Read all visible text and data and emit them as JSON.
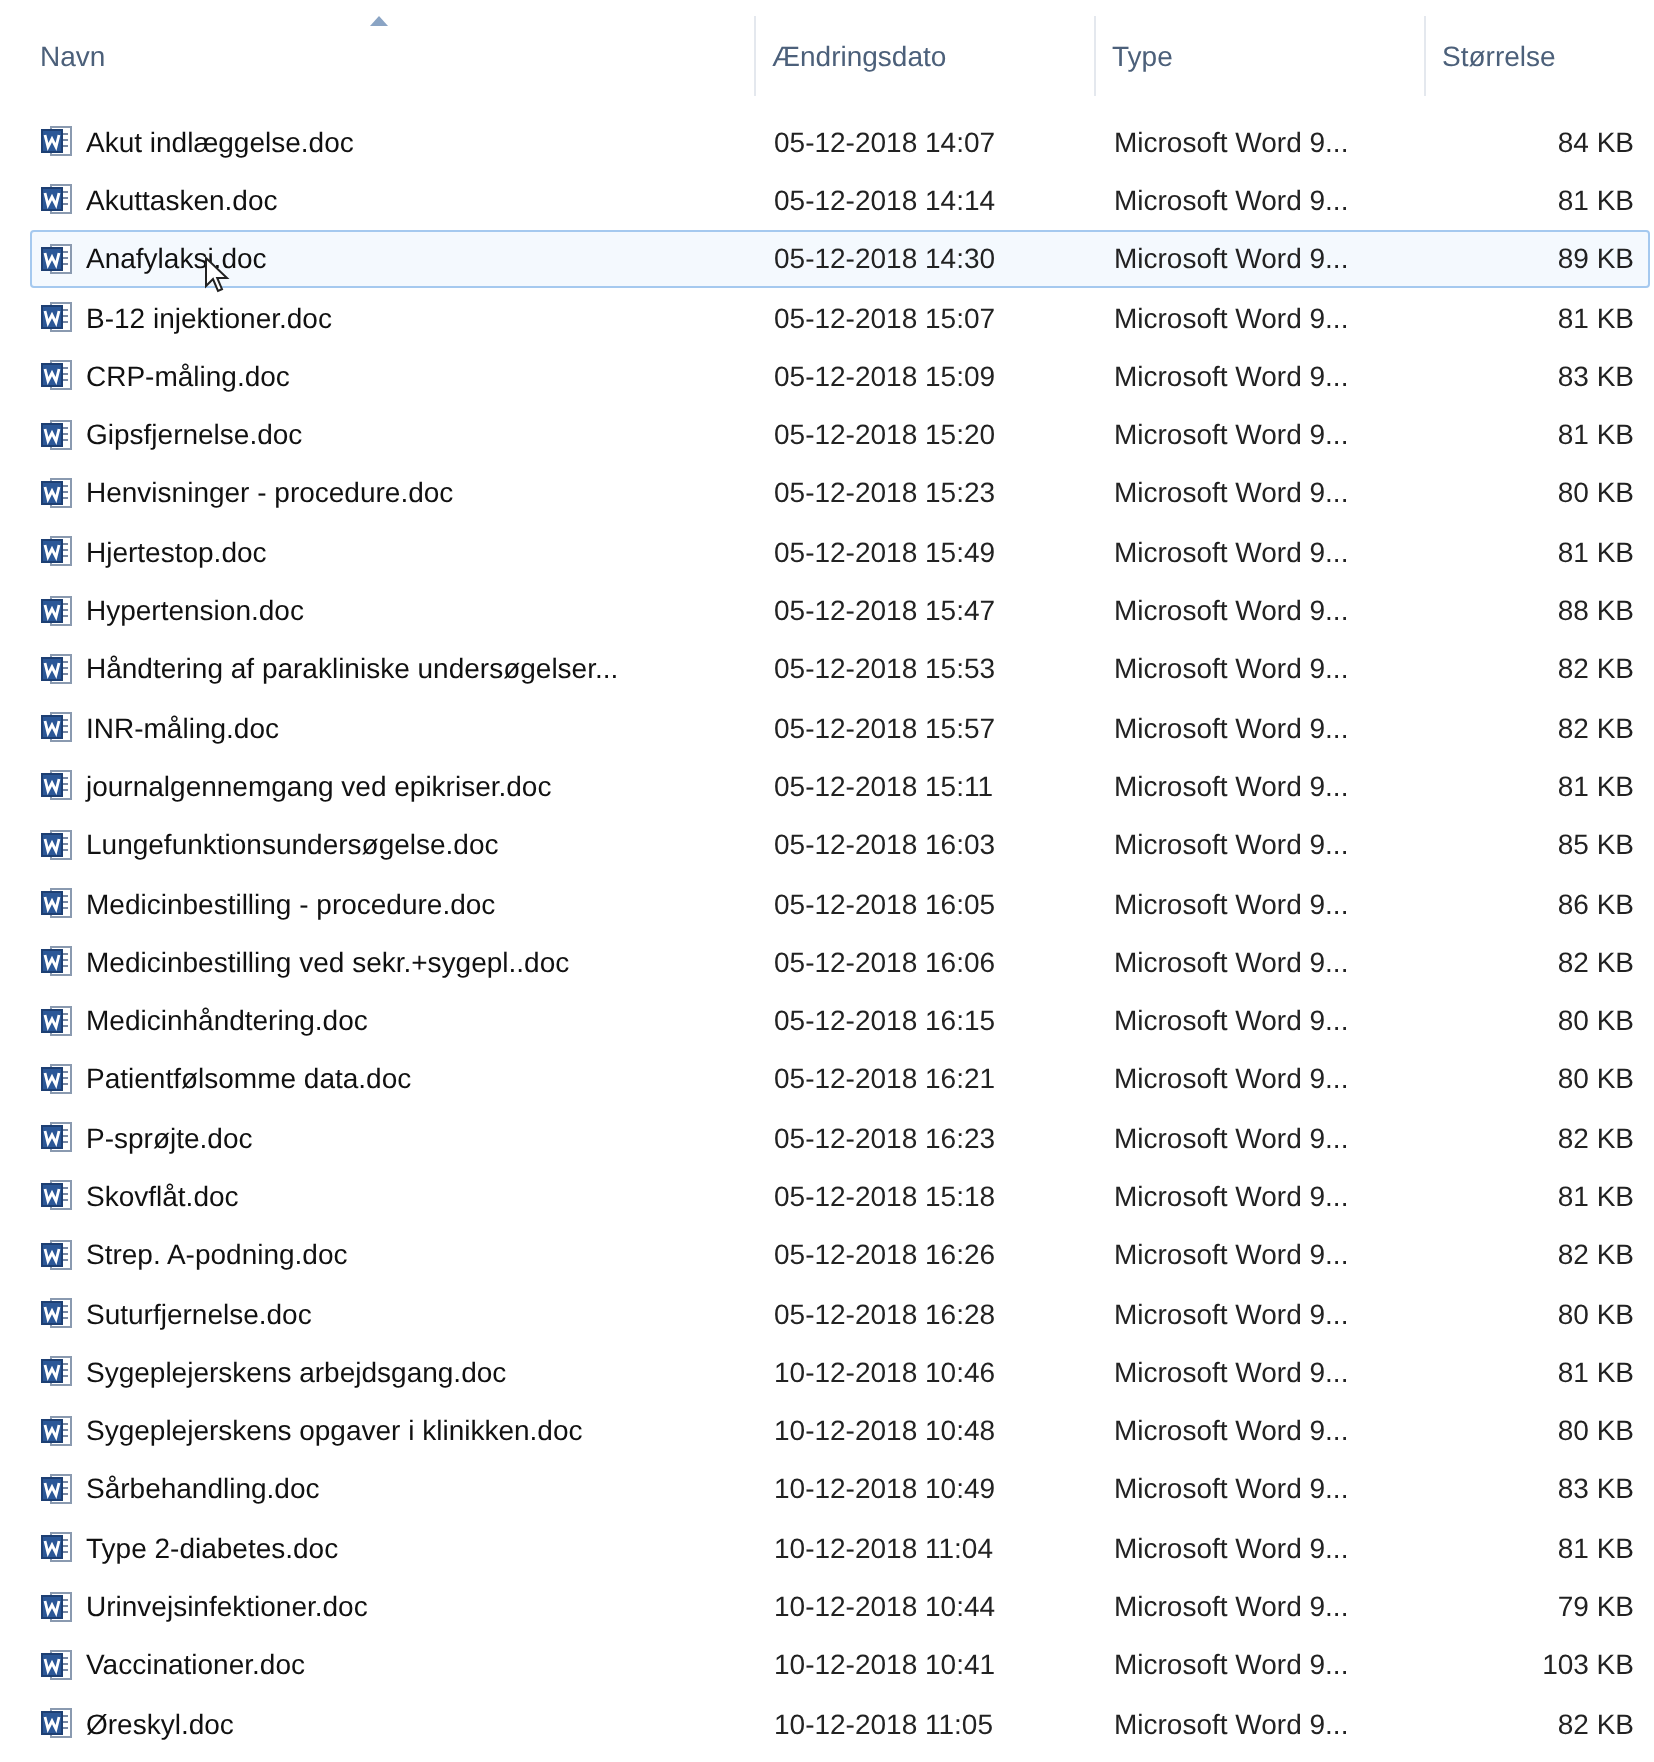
{
  "columns": [
    {
      "label": "Navn",
      "sorted": true
    },
    {
      "label": "Ændringsdato",
      "sorted": false
    },
    {
      "label": "Type",
      "sorted": false
    },
    {
      "label": "Størrelse",
      "sorted": false
    }
  ],
  "rows": [
    {
      "name": "Akut indlæggelse.doc",
      "date": "05-12-2018 14:07",
      "type": "Microsoft Word 9...",
      "size": "84 KB",
      "hovered": false
    },
    {
      "name": "Akuttasken.doc",
      "date": "05-12-2018 14:14",
      "type": "Microsoft Word 9...",
      "size": "81 KB",
      "hovered": false
    },
    {
      "name": "Anafylaksi.doc",
      "date": "05-12-2018 14:30",
      "type": "Microsoft Word 9...",
      "size": "89 KB",
      "hovered": true
    },
    {
      "name": "B-12 injektioner.doc",
      "date": "05-12-2018 15:07",
      "type": "Microsoft Word 9...",
      "size": "81 KB",
      "hovered": false
    },
    {
      "name": "CRP-måling.doc",
      "date": "05-12-2018 15:09",
      "type": "Microsoft Word 9...",
      "size": "83 KB",
      "hovered": false
    },
    {
      "name": "Gipsfjernelse.doc",
      "date": "05-12-2018 15:20",
      "type": "Microsoft Word 9...",
      "size": "81 KB",
      "hovered": false
    },
    {
      "name": "Henvisninger - procedure.doc",
      "date": "05-12-2018 15:23",
      "type": "Microsoft Word 9...",
      "size": "80 KB",
      "hovered": false
    },
    {
      "name": "Hjertestop.doc",
      "date": "05-12-2018 15:49",
      "type": "Microsoft Word 9...",
      "size": "81 KB",
      "hovered": false
    },
    {
      "name": "Hypertension.doc",
      "date": "05-12-2018 15:47",
      "type": "Microsoft Word 9...",
      "size": "88 KB",
      "hovered": false
    },
    {
      "name": "Håndtering af parakliniske undersøgelser...",
      "date": "05-12-2018 15:53",
      "type": "Microsoft Word 9...",
      "size": "82 KB",
      "hovered": false
    },
    {
      "name": "INR-måling.doc",
      "date": "05-12-2018 15:57",
      "type": "Microsoft Word 9...",
      "size": "82 KB",
      "hovered": false
    },
    {
      "name": "journalgennemgang ved epikriser.doc",
      "date": "05-12-2018 15:11",
      "type": "Microsoft Word 9...",
      "size": "81 KB",
      "hovered": false
    },
    {
      "name": "Lungefunktionsundersøgelse.doc",
      "date": "05-12-2018 16:03",
      "type": "Microsoft Word 9...",
      "size": "85 KB",
      "hovered": false
    },
    {
      "name": "Medicinbestilling - procedure.doc",
      "date": "05-12-2018 16:05",
      "type": "Microsoft Word 9...",
      "size": "86 KB",
      "hovered": false
    },
    {
      "name": "Medicinbestilling ved sekr.+sygepl..doc",
      "date": "05-12-2018 16:06",
      "type": "Microsoft Word 9...",
      "size": "82 KB",
      "hovered": false
    },
    {
      "name": "Medicinhåndtering.doc",
      "date": "05-12-2018 16:15",
      "type": "Microsoft Word 9...",
      "size": "80 KB",
      "hovered": false
    },
    {
      "name": "Patientfølsomme data.doc",
      "date": "05-12-2018 16:21",
      "type": "Microsoft Word 9...",
      "size": "80 KB",
      "hovered": false
    },
    {
      "name": "P-sprøjte.doc",
      "date": "05-12-2018 16:23",
      "type": "Microsoft Word 9...",
      "size": "82 KB",
      "hovered": false
    },
    {
      "name": "Skovflåt.doc",
      "date": "05-12-2018 15:18",
      "type": "Microsoft Word 9...",
      "size": "81 KB",
      "hovered": false
    },
    {
      "name": "Strep. A-podning.doc",
      "date": "05-12-2018 16:26",
      "type": "Microsoft Word 9...",
      "size": "82 KB",
      "hovered": false
    },
    {
      "name": "Suturfjernelse.doc",
      "date": "05-12-2018 16:28",
      "type": "Microsoft Word 9...",
      "size": "80 KB",
      "hovered": false
    },
    {
      "name": "Sygeplejerskens arbejdsgang.doc",
      "date": "10-12-2018 10:46",
      "type": "Microsoft Word 9...",
      "size": "81 KB",
      "hovered": false
    },
    {
      "name": "Sygeplejerskens opgaver i klinikken.doc",
      "date": "10-12-2018 10:48",
      "type": "Microsoft Word 9...",
      "size": "80 KB",
      "hovered": false
    },
    {
      "name": "Sårbehandling.doc",
      "date": "10-12-2018 10:49",
      "type": "Microsoft Word 9...",
      "size": "83 KB",
      "hovered": false
    },
    {
      "name": "Type 2-diabetes.doc",
      "date": "10-12-2018 11:04",
      "type": "Microsoft Word 9...",
      "size": "81 KB",
      "hovered": false
    },
    {
      "name": "Urinvejsinfektioner.doc",
      "date": "10-12-2018 10:44",
      "type": "Microsoft Word 9...",
      "size": "79 KB",
      "hovered": false
    },
    {
      "name": "Vaccinationer.doc",
      "date": "10-12-2018 10:41",
      "type": "Microsoft Word 9...",
      "size": "103 KB",
      "hovered": false
    },
    {
      "name": "Øreskyl.doc",
      "date": "10-12-2018 11:05",
      "type": "Microsoft Word 9...",
      "size": "82 KB",
      "hovered": false
    }
  ]
}
